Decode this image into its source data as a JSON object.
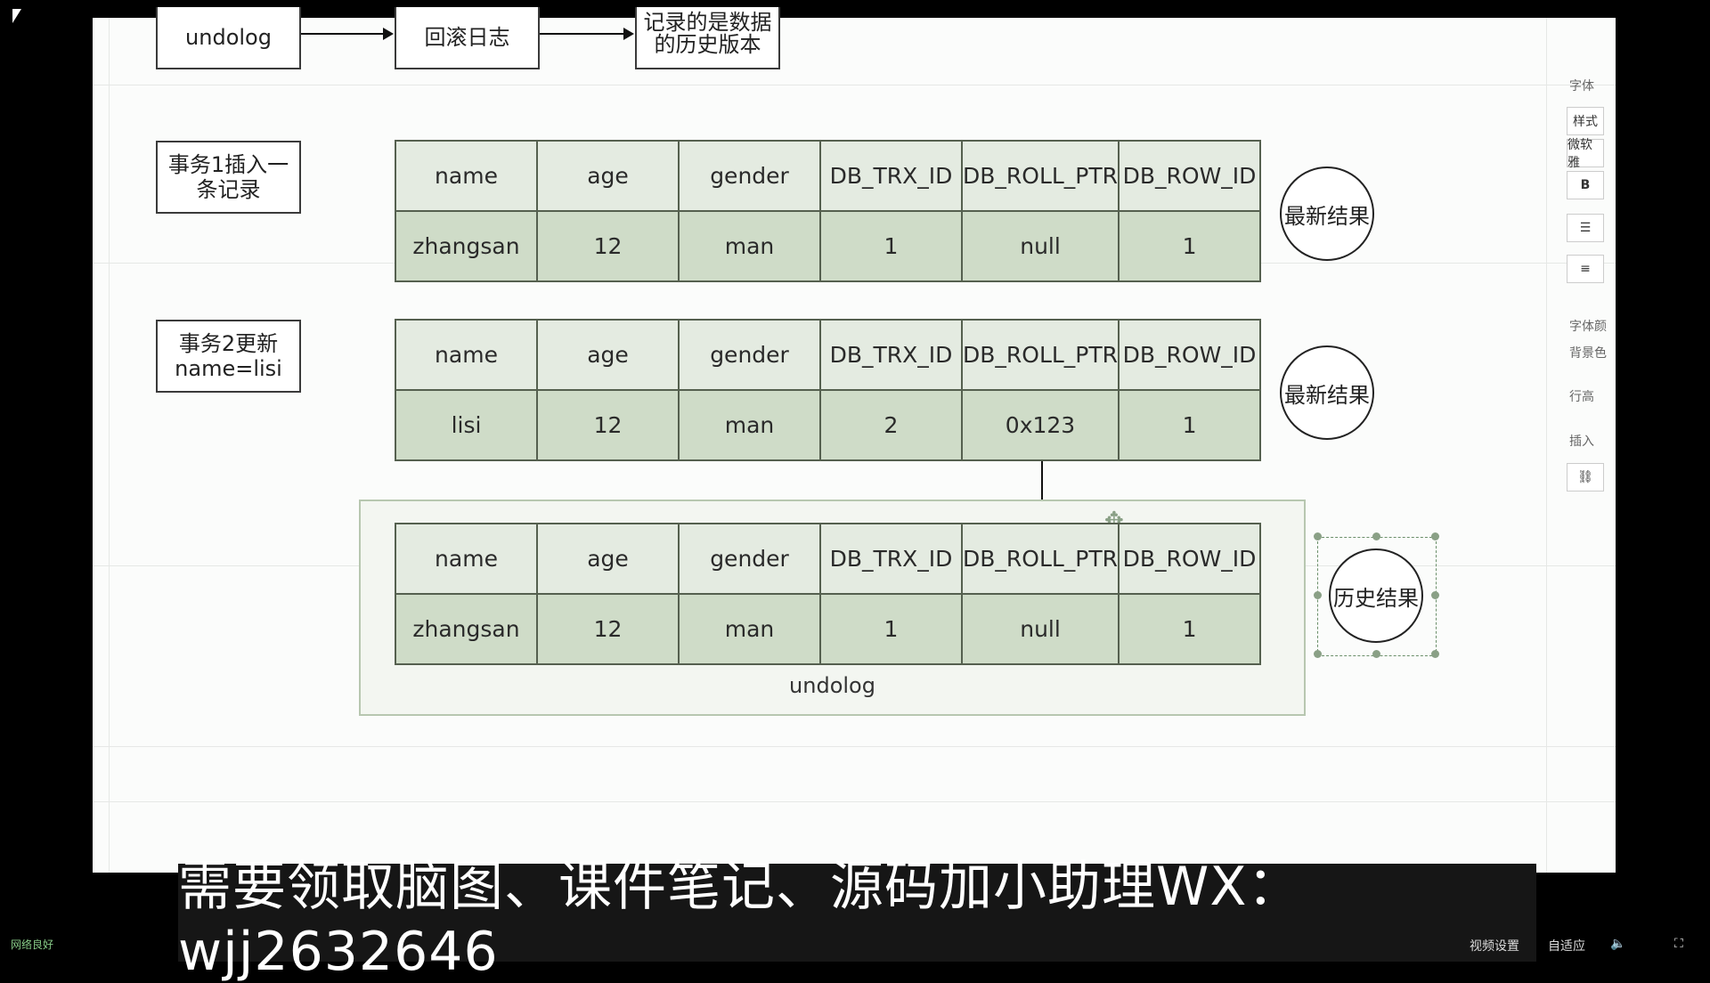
{
  "flow": {
    "box1": "undolog",
    "box2": "回滚日志",
    "box3_line1": "记录的是数据",
    "box3_line2": "的历史版本"
  },
  "steps": {
    "step1_line1": "事务1插入一",
    "step1_line2": "条记录",
    "step2_line1": "事务2更新",
    "step2_line2": "name=lisi"
  },
  "table_headers": [
    "name",
    "age",
    "gender",
    "DB_TRX_ID",
    "DB_ROLL_PTR",
    "DB_ROW_ID"
  ],
  "table1_values": [
    "zhangsan",
    "12",
    "man",
    "1",
    "null",
    "1"
  ],
  "table2_values": [
    "lisi",
    "12",
    "man",
    "2",
    "0x123",
    "1"
  ],
  "table3_values": [
    "zhangsan",
    "12",
    "man",
    "1",
    "null",
    "1"
  ],
  "labels": {
    "latest1": "最新结果",
    "latest2": "最新结果",
    "history": "历史结果",
    "undolog_group": "undolog"
  },
  "right_panel": {
    "font": "字体",
    "style": "样式",
    "font_name": "微软雅",
    "bold": "B",
    "font_color": "字体颜",
    "bg_color": "背景色",
    "line_spacing": "行高",
    "insert": "插入"
  },
  "subtitle": "需要领取脑图、课件笔记、源码加小助理WX：wjj2632646",
  "bottom": {
    "left": "网络良好",
    "video_settings": "视频设置",
    "adaptive": "自适应"
  }
}
